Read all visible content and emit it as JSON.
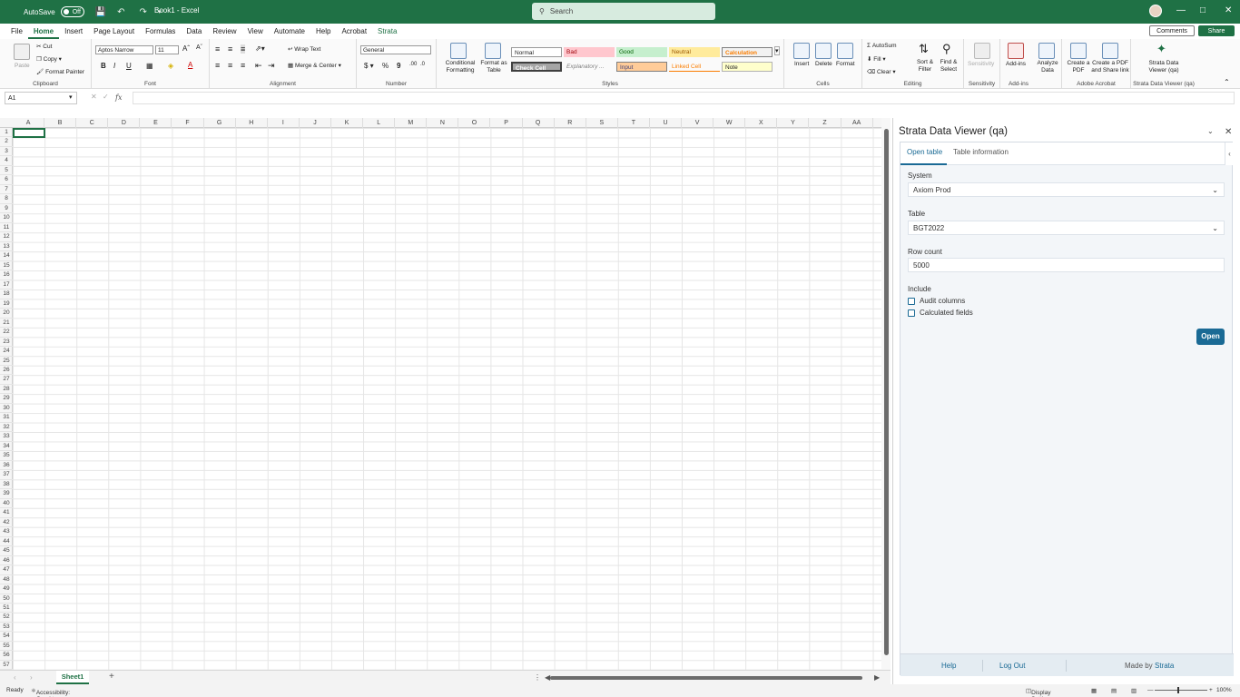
{
  "titlebar": {
    "autosave_label": "AutoSave",
    "autosave_state": "Off",
    "title": "Book1 - Excel",
    "search_placeholder": "Search"
  },
  "tabs": [
    "File",
    "Home",
    "Insert",
    "Page Layout",
    "Formulas",
    "Data",
    "Review",
    "View",
    "Automate",
    "Help",
    "Acrobat",
    "Strata"
  ],
  "comments_label": "Comments",
  "share_label": "Share",
  "ribbon": {
    "clipboard": {
      "paste": "Paste",
      "cut": "Cut",
      "copy": "Copy",
      "format_painter": "Format Painter",
      "label": "Clipboard"
    },
    "font": {
      "name": "Aptos Narrow",
      "size": "11",
      "label": "Font"
    },
    "alignment": {
      "wrap": "Wrap Text",
      "merge": "Merge & Center",
      "label": "Alignment"
    },
    "number": {
      "format": "General",
      "label": "Number"
    },
    "styles": {
      "conditional": "Conditional Formatting",
      "format_table": "Format as Table",
      "cells": [
        "Normal",
        "Bad",
        "Good",
        "Neutral",
        "Calculation",
        "Check Cell",
        "Explanatory ...",
        "Input",
        "Linked Cell",
        "Note"
      ],
      "label": "Styles"
    },
    "cells": {
      "insert": "Insert",
      "delete": "Delete",
      "format": "Format",
      "label": "Cells"
    },
    "editing": {
      "autosum": "AutoSum",
      "fill": "Fill",
      "clear": "Clear",
      "sort": "Sort & Filter",
      "find": "Find & Select",
      "label": "Editing"
    },
    "sensitivity": {
      "btn": "Sensitivity",
      "label": "Sensitivity"
    },
    "addins": {
      "btn": "Add-ins",
      "analyze": "Analyze Data",
      "label": "Add-ins"
    },
    "acrobat": {
      "create_pdf": "Create a PDF",
      "share_link": "Create a PDF and Share link",
      "label": "Adobe Acrobat"
    },
    "strata": {
      "btn": "Strata Data Viewer (qa)",
      "label": "Strata Data Viewer (qa)"
    }
  },
  "formula": {
    "namebox": "A1",
    "fx": "fx"
  },
  "columns": [
    "A",
    "B",
    "C",
    "D",
    "E",
    "F",
    "G",
    "H",
    "I",
    "J",
    "K",
    "L",
    "M",
    "N",
    "O",
    "P",
    "Q",
    "R",
    "S",
    "T",
    "U",
    "V",
    "W",
    "X",
    "Y",
    "Z",
    "AA"
  ],
  "rows_count": 57,
  "sheet_tab": "Sheet1",
  "status": {
    "ready": "Ready",
    "accessibility": "Accessibility: Good to go",
    "display": "Display Settings",
    "zoom": "100%"
  },
  "pane": {
    "title": "Strata Data Viewer (qa)",
    "tab_open": "Open table",
    "tab_info": "Table information",
    "system_label": "System",
    "system_value": "Axiom Prod",
    "table_label": "Table",
    "table_value": "BGT2022",
    "rowcount_label": "Row count",
    "rowcount_value": "5000",
    "include_label": "Include",
    "audit_label": "Audit columns",
    "calc_label": "Calculated fields",
    "open_btn": "Open",
    "help": "Help",
    "logout": "Log Out",
    "made_by": "Made by",
    "brand": "Strata"
  }
}
